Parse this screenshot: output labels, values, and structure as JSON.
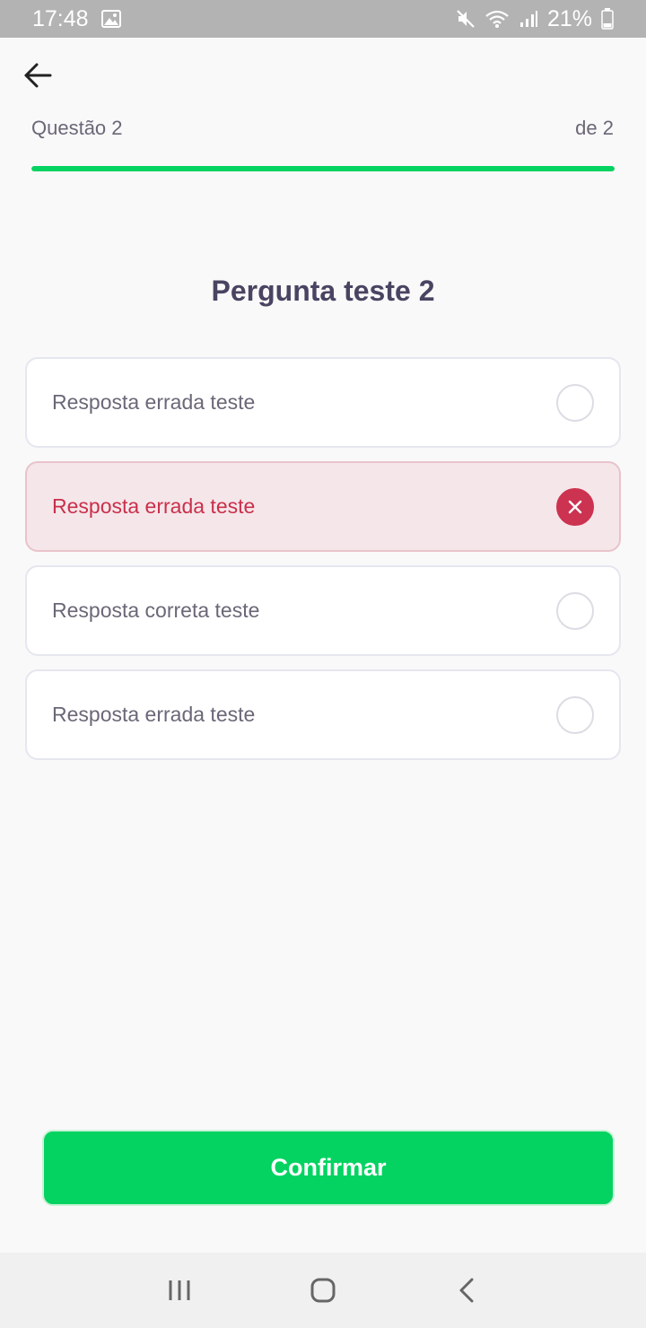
{
  "status_bar": {
    "time": "17:48",
    "battery": "21%",
    "icons": [
      "gallery-icon",
      "mute-icon",
      "wifi-icon",
      "signal-icon",
      "battery-icon"
    ]
  },
  "header": {
    "back_icon": "arrow-left-icon",
    "question_label": "Questão 2",
    "question_total": "de 2",
    "progress": 1.0
  },
  "question": {
    "title": "Pergunta teste 2",
    "options": [
      {
        "text": "Resposta errada teste",
        "state": "unselected"
      },
      {
        "text": "Resposta errada teste",
        "state": "wrong"
      },
      {
        "text": "Resposta correta teste",
        "state": "unselected"
      },
      {
        "text": "Resposta errada teste",
        "state": "unselected"
      }
    ]
  },
  "actions": {
    "confirm_label": "Confirmar"
  },
  "nav_bar": {
    "icons": [
      "recent-apps-icon",
      "home-icon",
      "back-icon"
    ]
  },
  "colors": {
    "accent_green": "#04d361",
    "wrong_red": "#cc3350",
    "wrong_bg": "#f5e6ea",
    "title": "#4a4462",
    "text": "#6b6777"
  }
}
